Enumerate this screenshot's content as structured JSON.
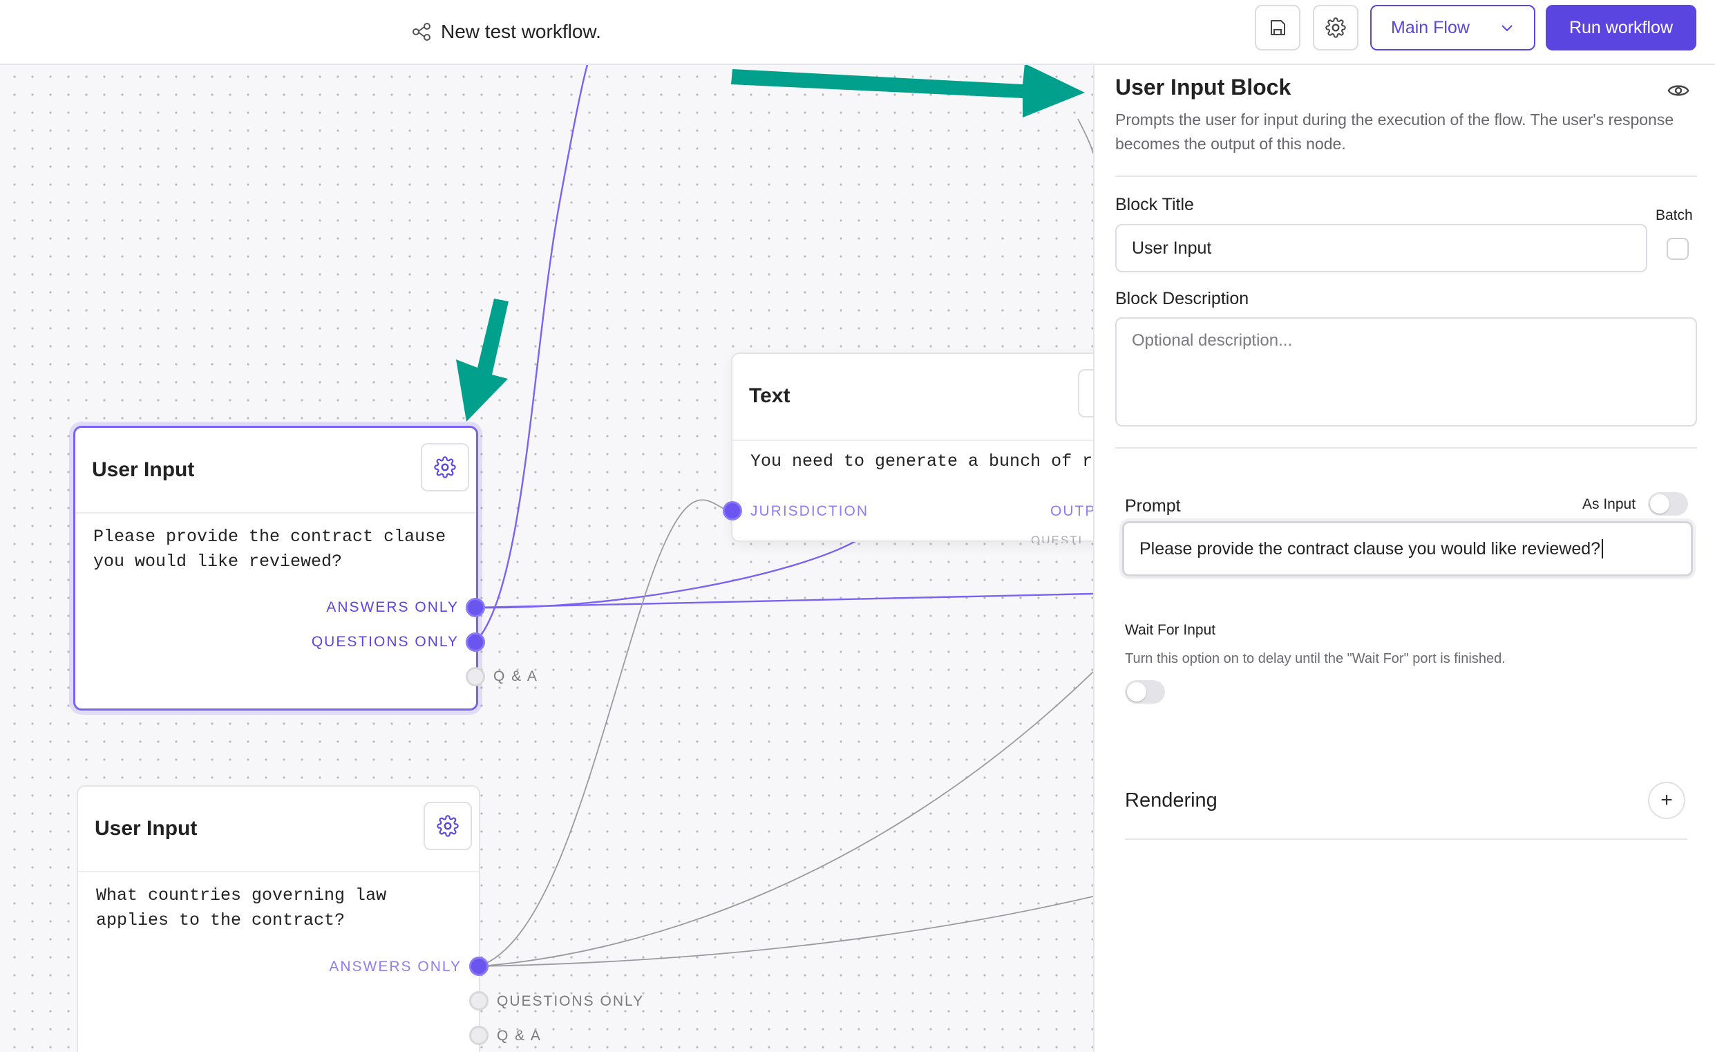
{
  "header": {
    "workflow_title": "New test workflow.",
    "flow_select_label": "Main Flow",
    "run_button_label": "Run workflow"
  },
  "canvas": {
    "nodes": [
      {
        "title": "User Input",
        "body": "Please provide the contract clause\nyou would like reviewed?",
        "selected": true,
        "ports": [
          {
            "label": "ANSWERS ONLY",
            "state": "on"
          },
          {
            "label": "QUESTIONS ONLY",
            "state": "on"
          },
          {
            "label": "Q & A",
            "state": "off"
          }
        ]
      },
      {
        "title": "Text",
        "body": "You need to generate a bunch of r",
        "ports": [
          {
            "label": "JURISDICTION",
            "state": "on"
          },
          {
            "label": "OUTP",
            "state": "out"
          },
          {
            "label": "QUESTI",
            "state": "out"
          }
        ]
      },
      {
        "title": "User Input",
        "body": "What countries governing law\napplies to the contract?",
        "ports": [
          {
            "label": "ANSWERS ONLY",
            "state": "on"
          },
          {
            "label": "QUESTIONS ONLY",
            "state": "off"
          },
          {
            "label": "Q & A",
            "state": "off"
          }
        ]
      }
    ]
  },
  "panel": {
    "title": "User Input Block",
    "description": "Prompts the user for input during the execution of the flow. The user's response becomes the output of this node.",
    "block_title_label": "Block Title",
    "batch_label": "Batch",
    "block_title_value": "User Input",
    "block_description_label": "Block Description",
    "block_description_placeholder": "Optional description...",
    "prompt_label": "Prompt",
    "as_input_label": "As Input",
    "prompt_value": "Please provide the contract clause you would like reviewed?",
    "wait_label": "Wait For Input",
    "wait_help": "Turn this option on to delay until the \"Wait For\" port is finished.",
    "rendering_label": "Rendering",
    "rendering_toggle_glyph": "+"
  },
  "colors": {
    "accent": "#5b45e0",
    "annotation_arrow": "#00a08c"
  }
}
